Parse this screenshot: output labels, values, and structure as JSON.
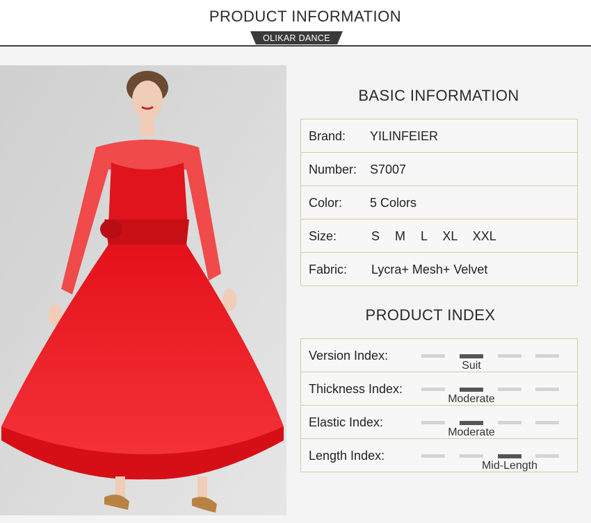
{
  "header": {
    "title": "PRODUCT INFORMATION",
    "badge": "OLIKAR DANCE"
  },
  "photo": {
    "subject": "model wearing red long-sleeve ballroom dance dress"
  },
  "basic": {
    "title": "BASIC INFORMATION",
    "rows": [
      {
        "label": "Brand:",
        "value": "YILINFEIER"
      },
      {
        "label": "Number:",
        "value": "S7007"
      },
      {
        "label": "Color:",
        "value": "5 Colors"
      },
      {
        "label": "Size:",
        "value": "S  M  L  XL  XXL"
      },
      {
        "label": "Fabric:",
        "value": "Lycra+ Mesh+ Velvet"
      }
    ]
  },
  "index": {
    "title": "PRODUCT INDEX",
    "rows": [
      {
        "label": "Version Index:",
        "selected": 1,
        "level": "Suit"
      },
      {
        "label": "Thickness Index:",
        "selected": 1,
        "level": "Moderate"
      },
      {
        "label": "Elastic Index:",
        "selected": 1,
        "level": "Moderate"
      },
      {
        "label": "Length Index:",
        "selected": 2,
        "level": "Mid-Length"
      }
    ]
  },
  "colors": {
    "dress": "#e8141c",
    "accent": "#3a3a3a",
    "border": "#d9c9a6",
    "bar_on": "#555555",
    "bar_off": "#d4d4d4"
  }
}
